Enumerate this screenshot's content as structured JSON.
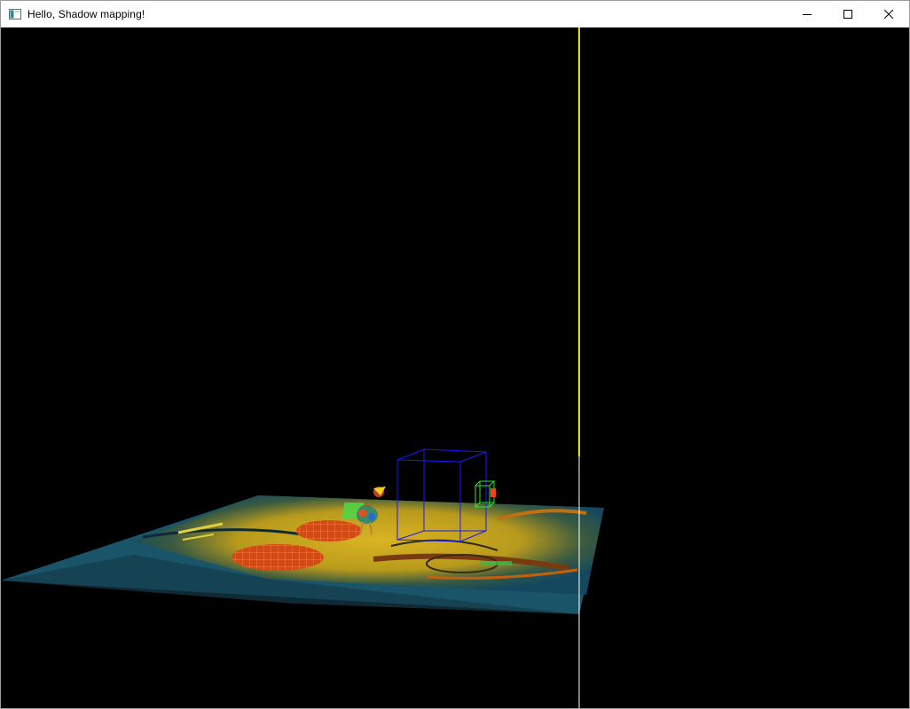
{
  "window": {
    "title": "Hello, Shadow mapping!",
    "icon": "app-window-icon",
    "controls": [
      "minimize-icon",
      "maximize-icon",
      "close-icon"
    ]
  },
  "scene": {
    "background": "#000000",
    "colors": {
      "light_line": "#e8e000",
      "light_line_lower": "#ffffff",
      "frustum_blue": "#1a1aff",
      "frustum_green": "#22ee22",
      "light_marker": "#ff3a1a",
      "floor_teal": "#1c5870",
      "floor_yellow": "#c8a820",
      "spot_red": "#d24a14",
      "highlight_green": "#4ad84a"
    }
  }
}
